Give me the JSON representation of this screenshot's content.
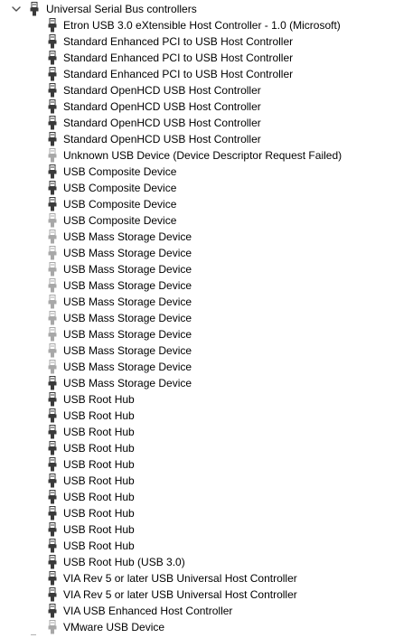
{
  "tree": {
    "category": {
      "label": "Universal Serial Bus controllers",
      "expanded": true,
      "icon": "usb-plug-icon"
    },
    "devices": [
      {
        "label": "Etron USB 3.0 eXtensible Host Controller - 1.0 (Microsoft)",
        "icon": "usb-plug-icon",
        "state": "normal"
      },
      {
        "label": "Standard Enhanced PCI to USB Host Controller",
        "icon": "usb-plug-icon",
        "state": "normal"
      },
      {
        "label": "Standard Enhanced PCI to USB Host Controller",
        "icon": "usb-plug-icon",
        "state": "normal"
      },
      {
        "label": "Standard Enhanced PCI to USB Host Controller",
        "icon": "usb-plug-icon",
        "state": "normal"
      },
      {
        "label": "Standard OpenHCD USB Host Controller",
        "icon": "usb-plug-icon",
        "state": "normal"
      },
      {
        "label": "Standard OpenHCD USB Host Controller",
        "icon": "usb-plug-icon",
        "state": "normal"
      },
      {
        "label": "Standard OpenHCD USB Host Controller",
        "icon": "usb-plug-icon",
        "state": "normal"
      },
      {
        "label": "Standard OpenHCD USB Host Controller",
        "icon": "usb-plug-icon",
        "state": "normal"
      },
      {
        "label": "Unknown USB Device (Device Descriptor Request Failed)",
        "icon": "usb-plug-icon",
        "state": "disconnected"
      },
      {
        "label": "USB Composite Device",
        "icon": "usb-plug-icon",
        "state": "normal"
      },
      {
        "label": "USB Composite Device",
        "icon": "usb-plug-icon",
        "state": "normal"
      },
      {
        "label": "USB Composite Device",
        "icon": "usb-plug-icon",
        "state": "normal"
      },
      {
        "label": "USB Composite Device",
        "icon": "usb-plug-icon",
        "state": "disconnected"
      },
      {
        "label": "USB Mass Storage Device",
        "icon": "usb-plug-icon",
        "state": "disconnected"
      },
      {
        "label": "USB Mass Storage Device",
        "icon": "usb-plug-icon",
        "state": "disconnected"
      },
      {
        "label": "USB Mass Storage Device",
        "icon": "usb-plug-icon",
        "state": "disconnected"
      },
      {
        "label": "USB Mass Storage Device",
        "icon": "usb-plug-icon",
        "state": "disconnected"
      },
      {
        "label": "USB Mass Storage Device",
        "icon": "usb-plug-icon",
        "state": "disconnected"
      },
      {
        "label": "USB Mass Storage Device",
        "icon": "usb-plug-icon",
        "state": "disconnected"
      },
      {
        "label": "USB Mass Storage Device",
        "icon": "usb-plug-icon",
        "state": "disconnected"
      },
      {
        "label": "USB Mass Storage Device",
        "icon": "usb-plug-icon",
        "state": "disconnected"
      },
      {
        "label": "USB Mass Storage Device",
        "icon": "usb-plug-icon",
        "state": "disconnected"
      },
      {
        "label": "USB Mass Storage Device",
        "icon": "usb-plug-icon",
        "state": "normal"
      },
      {
        "label": "USB Root Hub",
        "icon": "usb-plug-icon",
        "state": "normal"
      },
      {
        "label": "USB Root Hub",
        "icon": "usb-plug-icon",
        "state": "normal"
      },
      {
        "label": "USB Root Hub",
        "icon": "usb-plug-icon",
        "state": "normal"
      },
      {
        "label": "USB Root Hub",
        "icon": "usb-plug-icon",
        "state": "normal"
      },
      {
        "label": "USB Root Hub",
        "icon": "usb-plug-icon",
        "state": "normal"
      },
      {
        "label": "USB Root Hub",
        "icon": "usb-plug-icon",
        "state": "normal"
      },
      {
        "label": "USB Root Hub",
        "icon": "usb-plug-icon",
        "state": "normal"
      },
      {
        "label": "USB Root Hub",
        "icon": "usb-plug-icon",
        "state": "normal"
      },
      {
        "label": "USB Root Hub",
        "icon": "usb-plug-icon",
        "state": "normal"
      },
      {
        "label": "USB Root Hub",
        "icon": "usb-plug-icon",
        "state": "normal"
      },
      {
        "label": "USB Root Hub (USB 3.0)",
        "icon": "usb-plug-icon",
        "state": "normal"
      },
      {
        "label": "VIA Rev 5 or later USB Universal Host Controller",
        "icon": "usb-plug-icon",
        "state": "normal"
      },
      {
        "label": "VIA Rev 5 or later USB Universal Host Controller",
        "icon": "usb-plug-icon",
        "state": "normal"
      },
      {
        "label": "VIA USB Enhanced Host Controller",
        "icon": "usb-plug-icon",
        "state": "normal"
      },
      {
        "label": "VMware USB Device",
        "icon": "usb-plug-icon",
        "state": "disconnected"
      }
    ]
  },
  "colors": {
    "text": "#000000",
    "icon_normal": "#3a3a3a",
    "icon_disconnected": "#a8a8a8",
    "expander": "#505050",
    "background": "#ffffff"
  }
}
